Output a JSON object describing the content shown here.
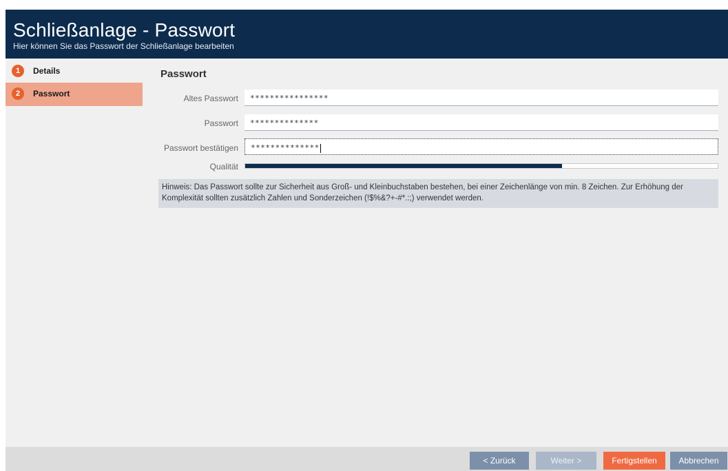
{
  "header": {
    "title": "Schließanlage - Passwort",
    "subtitle": "Hier können Sie das Passwort der Schließanlage bearbeiten"
  },
  "steps": [
    {
      "number": "1",
      "label": "Details",
      "active": false
    },
    {
      "number": "2",
      "label": "Passwort",
      "active": true
    }
  ],
  "main": {
    "section_title": "Passwort",
    "fields": {
      "old_password": {
        "label": "Altes Passwort",
        "value": "****************"
      },
      "password": {
        "label": "Passwort",
        "value": "**************"
      },
      "confirm_password": {
        "label": "Passwort bestätigen",
        "value": "**************"
      }
    },
    "quality": {
      "label": "Qualität",
      "fraction": 0.67
    },
    "hint": "Hinweis: Das Passwort sollte zur Sicherheit aus Groß- und Kleinbuchstaben bestehen, bei einer Zeichenlänge von min. 8 Zeichen. Zur Erhöhung der Komplexität sollten zusätzlich Zahlen und Sonderzeichen (!$%&?+-#*.:;) verwendet werden."
  },
  "footer": {
    "back_label": "< Zurück",
    "next_label": "Weiter >",
    "finish_label": "Fertigstellen",
    "cancel_label": "Abbrechen"
  },
  "colors": {
    "header_bg": "#0d2c4d",
    "accent_orange": "#ef6a42",
    "active_step_bg": "#eea58c",
    "quality_fill": "#0d2c4d"
  }
}
